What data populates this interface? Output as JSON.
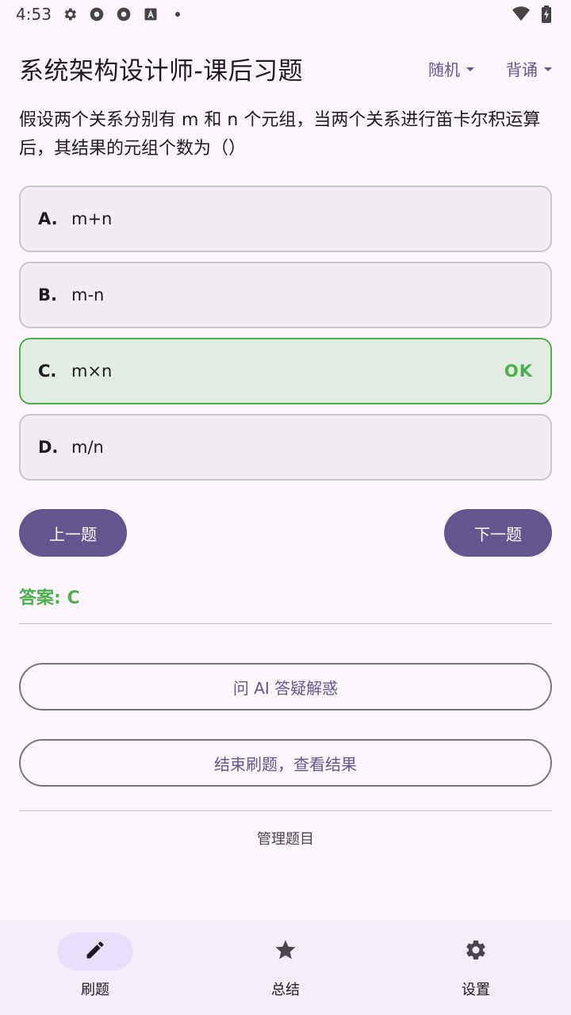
{
  "status_bar": {
    "time": "4:53",
    "icons": [
      "settings-icon",
      "aperture-icon",
      "aperture-icon",
      "text-a-icon",
      "dot-icon",
      "wifi-icon",
      "battery-icon"
    ]
  },
  "header": {
    "title": "系统架构设计师-课后习题",
    "mode_dropdown": "随机",
    "study_dropdown": "背诵"
  },
  "question": {
    "text": "假设两个关系分别有 m 和 n 个元组，当两个关系进行笛卡尔积运算后，其结果的元组个数为（）"
  },
  "options": [
    {
      "letter": "A.",
      "text": "m+n",
      "status": ""
    },
    {
      "letter": "B.",
      "text": "m-n",
      "status": ""
    },
    {
      "letter": "C.",
      "text": "m×n",
      "status": "OK"
    },
    {
      "letter": "D.",
      "text": "m/n",
      "status": ""
    }
  ],
  "navigation": {
    "prev_label": "上一题",
    "next_label": "下一题"
  },
  "answer_text": "答案: C",
  "actions": {
    "ask_ai_label": "问 AI 答疑解惑",
    "finish_label": "结束刷题，查看结果",
    "manage_label": "管理题目"
  },
  "bottom_nav": [
    {
      "label": "刷题",
      "icon": "pencil-icon",
      "active": true
    },
    {
      "label": "总结",
      "icon": "star-icon",
      "active": false
    },
    {
      "label": "设置",
      "icon": "gear-icon",
      "active": false
    }
  ],
  "colors": {
    "primary": "#65558f",
    "correct": "#4caf50",
    "background": "#fdf7fd"
  }
}
